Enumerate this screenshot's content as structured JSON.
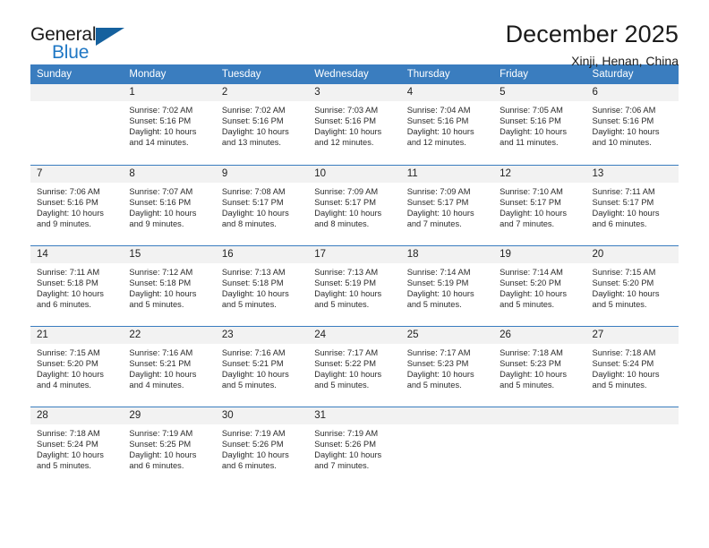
{
  "brand": {
    "name_primary": "General",
    "name_secondary": "Blue",
    "accent_color": "#15619e",
    "blue_text_color": "#1f77c4"
  },
  "header": {
    "title": "December 2025",
    "subtitle": "Xinji, Henan, China",
    "header_bg_color": "#3a7dbf"
  },
  "weekday_headers": [
    "Sunday",
    "Monday",
    "Tuesday",
    "Wednesday",
    "Thursday",
    "Friday",
    "Saturday"
  ],
  "weeks": [
    [
      {
        "day": "",
        "sunrise": "",
        "sunset": "",
        "daylight_line1": "",
        "daylight_line2": ""
      },
      {
        "day": "1",
        "sunrise": "Sunrise: 7:02 AM",
        "sunset": "Sunset: 5:16 PM",
        "daylight_line1": "Daylight: 10 hours",
        "daylight_line2": "and 14 minutes."
      },
      {
        "day": "2",
        "sunrise": "Sunrise: 7:02 AM",
        "sunset": "Sunset: 5:16 PM",
        "daylight_line1": "Daylight: 10 hours",
        "daylight_line2": "and 13 minutes."
      },
      {
        "day": "3",
        "sunrise": "Sunrise: 7:03 AM",
        "sunset": "Sunset: 5:16 PM",
        "daylight_line1": "Daylight: 10 hours",
        "daylight_line2": "and 12 minutes."
      },
      {
        "day": "4",
        "sunrise": "Sunrise: 7:04 AM",
        "sunset": "Sunset: 5:16 PM",
        "daylight_line1": "Daylight: 10 hours",
        "daylight_line2": "and 12 minutes."
      },
      {
        "day": "5",
        "sunrise": "Sunrise: 7:05 AM",
        "sunset": "Sunset: 5:16 PM",
        "daylight_line1": "Daylight: 10 hours",
        "daylight_line2": "and 11 minutes."
      },
      {
        "day": "6",
        "sunrise": "Sunrise: 7:06 AM",
        "sunset": "Sunset: 5:16 PM",
        "daylight_line1": "Daylight: 10 hours",
        "daylight_line2": "and 10 minutes."
      }
    ],
    [
      {
        "day": "7",
        "sunrise": "Sunrise: 7:06 AM",
        "sunset": "Sunset: 5:16 PM",
        "daylight_line1": "Daylight: 10 hours",
        "daylight_line2": "and 9 minutes."
      },
      {
        "day": "8",
        "sunrise": "Sunrise: 7:07 AM",
        "sunset": "Sunset: 5:16 PM",
        "daylight_line1": "Daylight: 10 hours",
        "daylight_line2": "and 9 minutes."
      },
      {
        "day": "9",
        "sunrise": "Sunrise: 7:08 AM",
        "sunset": "Sunset: 5:17 PM",
        "daylight_line1": "Daylight: 10 hours",
        "daylight_line2": "and 8 minutes."
      },
      {
        "day": "10",
        "sunrise": "Sunrise: 7:09 AM",
        "sunset": "Sunset: 5:17 PM",
        "daylight_line1": "Daylight: 10 hours",
        "daylight_line2": "and 8 minutes."
      },
      {
        "day": "11",
        "sunrise": "Sunrise: 7:09 AM",
        "sunset": "Sunset: 5:17 PM",
        "daylight_line1": "Daylight: 10 hours",
        "daylight_line2": "and 7 minutes."
      },
      {
        "day": "12",
        "sunrise": "Sunrise: 7:10 AM",
        "sunset": "Sunset: 5:17 PM",
        "daylight_line1": "Daylight: 10 hours",
        "daylight_line2": "and 7 minutes."
      },
      {
        "day": "13",
        "sunrise": "Sunrise: 7:11 AM",
        "sunset": "Sunset: 5:17 PM",
        "daylight_line1": "Daylight: 10 hours",
        "daylight_line2": "and 6 minutes."
      }
    ],
    [
      {
        "day": "14",
        "sunrise": "Sunrise: 7:11 AM",
        "sunset": "Sunset: 5:18 PM",
        "daylight_line1": "Daylight: 10 hours",
        "daylight_line2": "and 6 minutes."
      },
      {
        "day": "15",
        "sunrise": "Sunrise: 7:12 AM",
        "sunset": "Sunset: 5:18 PM",
        "daylight_line1": "Daylight: 10 hours",
        "daylight_line2": "and 5 minutes."
      },
      {
        "day": "16",
        "sunrise": "Sunrise: 7:13 AM",
        "sunset": "Sunset: 5:18 PM",
        "daylight_line1": "Daylight: 10 hours",
        "daylight_line2": "and 5 minutes."
      },
      {
        "day": "17",
        "sunrise": "Sunrise: 7:13 AM",
        "sunset": "Sunset: 5:19 PM",
        "daylight_line1": "Daylight: 10 hours",
        "daylight_line2": "and 5 minutes."
      },
      {
        "day": "18",
        "sunrise": "Sunrise: 7:14 AM",
        "sunset": "Sunset: 5:19 PM",
        "daylight_line1": "Daylight: 10 hours",
        "daylight_line2": "and 5 minutes."
      },
      {
        "day": "19",
        "sunrise": "Sunrise: 7:14 AM",
        "sunset": "Sunset: 5:20 PM",
        "daylight_line1": "Daylight: 10 hours",
        "daylight_line2": "and 5 minutes."
      },
      {
        "day": "20",
        "sunrise": "Sunrise: 7:15 AM",
        "sunset": "Sunset: 5:20 PM",
        "daylight_line1": "Daylight: 10 hours",
        "daylight_line2": "and 5 minutes."
      }
    ],
    [
      {
        "day": "21",
        "sunrise": "Sunrise: 7:15 AM",
        "sunset": "Sunset: 5:20 PM",
        "daylight_line1": "Daylight: 10 hours",
        "daylight_line2": "and 4 minutes."
      },
      {
        "day": "22",
        "sunrise": "Sunrise: 7:16 AM",
        "sunset": "Sunset: 5:21 PM",
        "daylight_line1": "Daylight: 10 hours",
        "daylight_line2": "and 4 minutes."
      },
      {
        "day": "23",
        "sunrise": "Sunrise: 7:16 AM",
        "sunset": "Sunset: 5:21 PM",
        "daylight_line1": "Daylight: 10 hours",
        "daylight_line2": "and 5 minutes."
      },
      {
        "day": "24",
        "sunrise": "Sunrise: 7:17 AM",
        "sunset": "Sunset: 5:22 PM",
        "daylight_line1": "Daylight: 10 hours",
        "daylight_line2": "and 5 minutes."
      },
      {
        "day": "25",
        "sunrise": "Sunrise: 7:17 AM",
        "sunset": "Sunset: 5:23 PM",
        "daylight_line1": "Daylight: 10 hours",
        "daylight_line2": "and 5 minutes."
      },
      {
        "day": "26",
        "sunrise": "Sunrise: 7:18 AM",
        "sunset": "Sunset: 5:23 PM",
        "daylight_line1": "Daylight: 10 hours",
        "daylight_line2": "and 5 minutes."
      },
      {
        "day": "27",
        "sunrise": "Sunrise: 7:18 AM",
        "sunset": "Sunset: 5:24 PM",
        "daylight_line1": "Daylight: 10 hours",
        "daylight_line2": "and 5 minutes."
      }
    ],
    [
      {
        "day": "28",
        "sunrise": "Sunrise: 7:18 AM",
        "sunset": "Sunset: 5:24 PM",
        "daylight_line1": "Daylight: 10 hours",
        "daylight_line2": "and 5 minutes."
      },
      {
        "day": "29",
        "sunrise": "Sunrise: 7:19 AM",
        "sunset": "Sunset: 5:25 PM",
        "daylight_line1": "Daylight: 10 hours",
        "daylight_line2": "and 6 minutes."
      },
      {
        "day": "30",
        "sunrise": "Sunrise: 7:19 AM",
        "sunset": "Sunset: 5:26 PM",
        "daylight_line1": "Daylight: 10 hours",
        "daylight_line2": "and 6 minutes."
      },
      {
        "day": "31",
        "sunrise": "Sunrise: 7:19 AM",
        "sunset": "Sunset: 5:26 PM",
        "daylight_line1": "Daylight: 10 hours",
        "daylight_line2": "and 7 minutes."
      },
      {
        "day": "",
        "sunrise": "",
        "sunset": "",
        "daylight_line1": "",
        "daylight_line2": ""
      },
      {
        "day": "",
        "sunrise": "",
        "sunset": "",
        "daylight_line1": "",
        "daylight_line2": ""
      },
      {
        "day": "",
        "sunrise": "",
        "sunset": "",
        "daylight_line1": "",
        "daylight_line2": ""
      }
    ]
  ]
}
